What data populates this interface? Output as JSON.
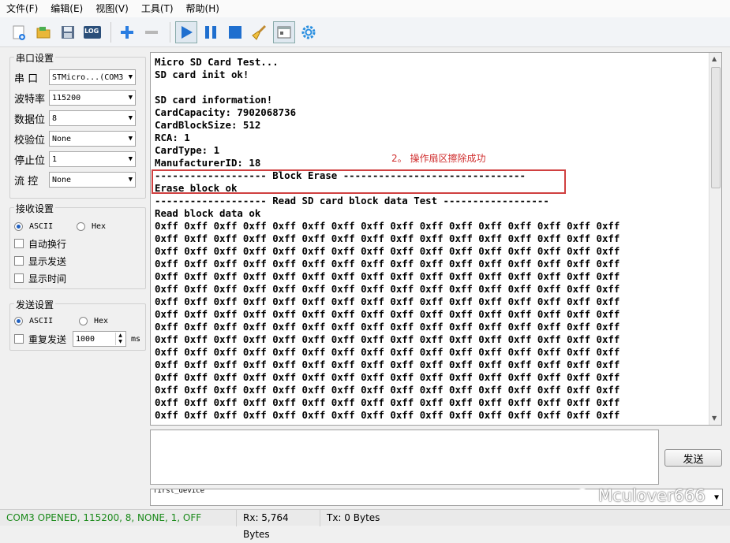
{
  "menu": [
    "文件(F)",
    "编辑(E)",
    "视图(V)",
    "工具(T)",
    "帮助(H)"
  ],
  "toolbar": {
    "log_label": "LOG",
    "icons": [
      "new-icon",
      "open-icon",
      "save-icon",
      "log-icon",
      "plus-icon",
      "minus-icon",
      "play-icon",
      "pause-icon",
      "stop-icon",
      "broom-icon",
      "window-icon",
      "gear-icon"
    ]
  },
  "serial": {
    "title": "串口设置",
    "port_label": "串 口",
    "port_value": "STMicro...(COM3",
    "baud_label": "波特率",
    "baud_value": "115200",
    "data_label": "数据位",
    "data_value": "8",
    "parity_label": "校验位",
    "parity_value": "None",
    "stop_label": "停止位",
    "stop_value": "1",
    "flow_label": "流 控",
    "flow_value": "None"
  },
  "receive": {
    "title": "接收设置",
    "ascii": "ASCII",
    "hex": "Hex",
    "auto_wrap": "自动换行",
    "show_send": "显示发送",
    "show_time": "显示时间"
  },
  "send": {
    "title": "发送设置",
    "ascii": "ASCII",
    "hex": "Hex",
    "repeat": "重复发送",
    "interval": "1000",
    "unit": "ms",
    "button": "发送"
  },
  "terminal": {
    "lines": [
      "Micro SD Card Test...",
      "SD card init ok!",
      "",
      "SD card information!",
      "CardCapacity: 7902068736",
      "CardBlockSize: 512",
      "RCA: 1",
      "CardType: 1",
      "ManufacturerID: 18",
      "------------------- Block Erase -------------------------------",
      "Erase block ok",
      "------------------- Read SD card block data Test ------------------",
      "Read block data ok",
      "0xff 0xff 0xff 0xff 0xff 0xff 0xff 0xff 0xff 0xff 0xff 0xff 0xff 0xff 0xff 0xff",
      "0xff 0xff 0xff 0xff 0xff 0xff 0xff 0xff 0xff 0xff 0xff 0xff 0xff 0xff 0xff 0xff",
      "0xff 0xff 0xff 0xff 0xff 0xff 0xff 0xff 0xff 0xff 0xff 0xff 0xff 0xff 0xff 0xff",
      "0xff 0xff 0xff 0xff 0xff 0xff 0xff 0xff 0xff 0xff 0xff 0xff 0xff 0xff 0xff 0xff",
      "0xff 0xff 0xff 0xff 0xff 0xff 0xff 0xff 0xff 0xff 0xff 0xff 0xff 0xff 0xff 0xff",
      "0xff 0xff 0xff 0xff 0xff 0xff 0xff 0xff 0xff 0xff 0xff 0xff 0xff 0xff 0xff 0xff",
      "0xff 0xff 0xff 0xff 0xff 0xff 0xff 0xff 0xff 0xff 0xff 0xff 0xff 0xff 0xff 0xff",
      "0xff 0xff 0xff 0xff 0xff 0xff 0xff 0xff 0xff 0xff 0xff 0xff 0xff 0xff 0xff 0xff",
      "0xff 0xff 0xff 0xff 0xff 0xff 0xff 0xff 0xff 0xff 0xff 0xff 0xff 0xff 0xff 0xff",
      "0xff 0xff 0xff 0xff 0xff 0xff 0xff 0xff 0xff 0xff 0xff 0xff 0xff 0xff 0xff 0xff",
      "0xff 0xff 0xff 0xff 0xff 0xff 0xff 0xff 0xff 0xff 0xff 0xff 0xff 0xff 0xff 0xff",
      "0xff 0xff 0xff 0xff 0xff 0xff 0xff 0xff 0xff 0xff 0xff 0xff 0xff 0xff 0xff 0xff",
      "0xff 0xff 0xff 0xff 0xff 0xff 0xff 0xff 0xff 0xff 0xff 0xff 0xff 0xff 0xff 0xff",
      "0xff 0xff 0xff 0xff 0xff 0xff 0xff 0xff 0xff 0xff 0xff 0xff 0xff 0xff 0xff 0xff",
      "0xff 0xff 0xff 0xff 0xff 0xff 0xff 0xff 0xff 0xff 0xff 0xff 0xff 0xff 0xff 0xff",
      "0xff 0xff 0xff 0xff 0xff 0xff 0xff 0xff 0xff 0xff 0xff 0xff 0xff 0xff 0xff 0xff"
    ],
    "annotation": "2。 操作扇区擦除成功"
  },
  "history_value": "first_device",
  "watermark": "Mculover666",
  "status": {
    "port": "COM3 OPENED, 115200, 8, NONE, 1, OFF",
    "rx": "Rx: 5,764 Bytes",
    "tx": "Tx: 0 Bytes"
  },
  "colors": {
    "status_port": "#1a8a1a",
    "annotation": "#d03030",
    "accent": "#2060c0"
  }
}
